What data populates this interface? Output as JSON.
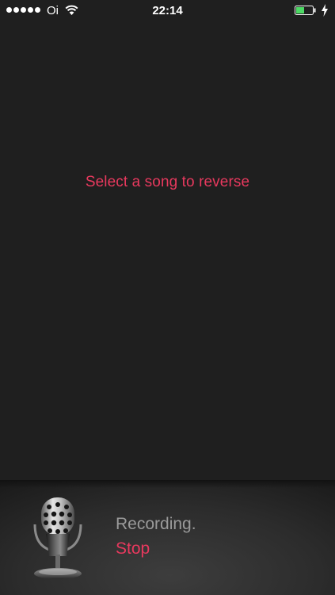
{
  "status_bar": {
    "carrier": "Oi",
    "time": "22:14",
    "battery_level": 0.5,
    "signal_bars": 5,
    "colors": {
      "battery_fill": "#4cd964"
    }
  },
  "main": {
    "prompt": "Select a song to reverse"
  },
  "recorder": {
    "status": "Recording.",
    "stop_label": "Stop",
    "icon": "microphone-icon"
  },
  "colors": {
    "accent": "#e8395e",
    "background": "#1f1f1f",
    "status_text": "#9a9a9a"
  }
}
